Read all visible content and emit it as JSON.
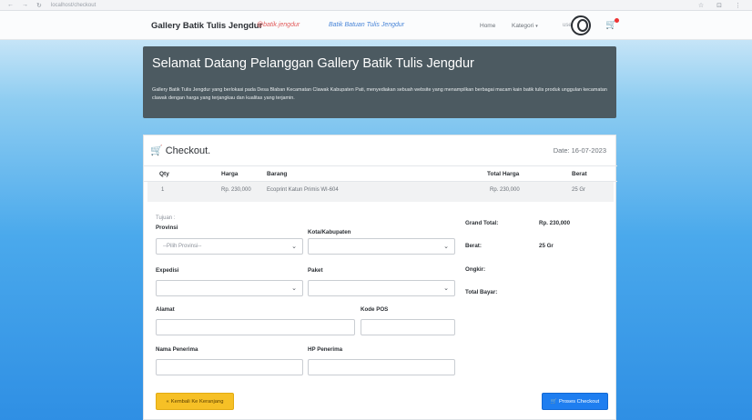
{
  "browser": {
    "back_icon": "←",
    "forward_icon": "→",
    "reload_icon": "↻",
    "url": "localhost/checkout",
    "right_icons": [
      "☆",
      "⊡",
      "⋮"
    ]
  },
  "navbar": {
    "brand": "Gallery Batik Tulis Jengdur",
    "tag1": "@batik.jengdur",
    "tag2": "Batik Batuan Tulis Jengdur",
    "home": "Home",
    "kategori": "Kategori",
    "kategori_caret": "▾",
    "user": "user",
    "cart_icon": "cart-icon"
  },
  "jumbotron": {
    "title": "Selamat Datang Pelanggan Gallery Batik Tulis Jengdur",
    "description": "Gallery Batik Tulis Jengdur yang berlokasi pada Desa Blaban Kecamatan Clawak Kabupaten Pati, menyediakan sebuah website yang menampilkan berbagai macam kain batik tulis produk unggulan kecamatan clawak dengan harga yang terjangkau dan kualitas yang terjamin."
  },
  "checkout": {
    "title": "Checkout.",
    "icon": "cart-icon",
    "date_label": "Date:",
    "date": "16-07-2023",
    "table": {
      "headers": [
        "Qty",
        "Harga",
        "Barang",
        "Total Harga",
        "Berat"
      ],
      "rows": [
        [
          "1",
          "Rp. 230,000",
          "Ecoprint Katun Primis WI-604",
          "Rp. 230,000",
          "25 Gr"
        ]
      ]
    },
    "form": {
      "tujuan": "Tujuan :",
      "provinsi_label": "Provinsi",
      "provinsi_value": "--Pilih Provinsi--",
      "kota_label": "Kota/Kabupaten",
      "kota_value": "",
      "ekspedisi_label": "Expedisi",
      "ekspedisi_value": "",
      "paket_label": "Paket",
      "paket_value": "",
      "alamat_label": "Alamat",
      "alamat_value": "",
      "kodepos_label": "Kode POS",
      "kodepos_value": "",
      "nama_label": "Nama Penerima",
      "nama_value": "",
      "hp_label": "HP Penerima",
      "hp_value": "",
      "chevron": "⌄"
    },
    "summary": {
      "grand_total_label": "Grand Total:",
      "grand_total_value": "Rp. 230,000",
      "berat_label": "Berat:",
      "berat_value": "25 Gr",
      "ongkir_label": "Ongkir:",
      "ongkir_value": "",
      "total_bayar_label": "Total Bayar:",
      "total_bayar_value": ""
    },
    "buttons": {
      "back_icon": "«",
      "back_label": "Kembali Ke Keranjang",
      "checkout_icon": "🛒",
      "checkout_label": "Proses Checkout"
    }
  },
  "colors": {
    "jumbotron_bg": "#4c5a61",
    "back_button": "#f6c026",
    "checkout_button": "#1e7ef0"
  }
}
